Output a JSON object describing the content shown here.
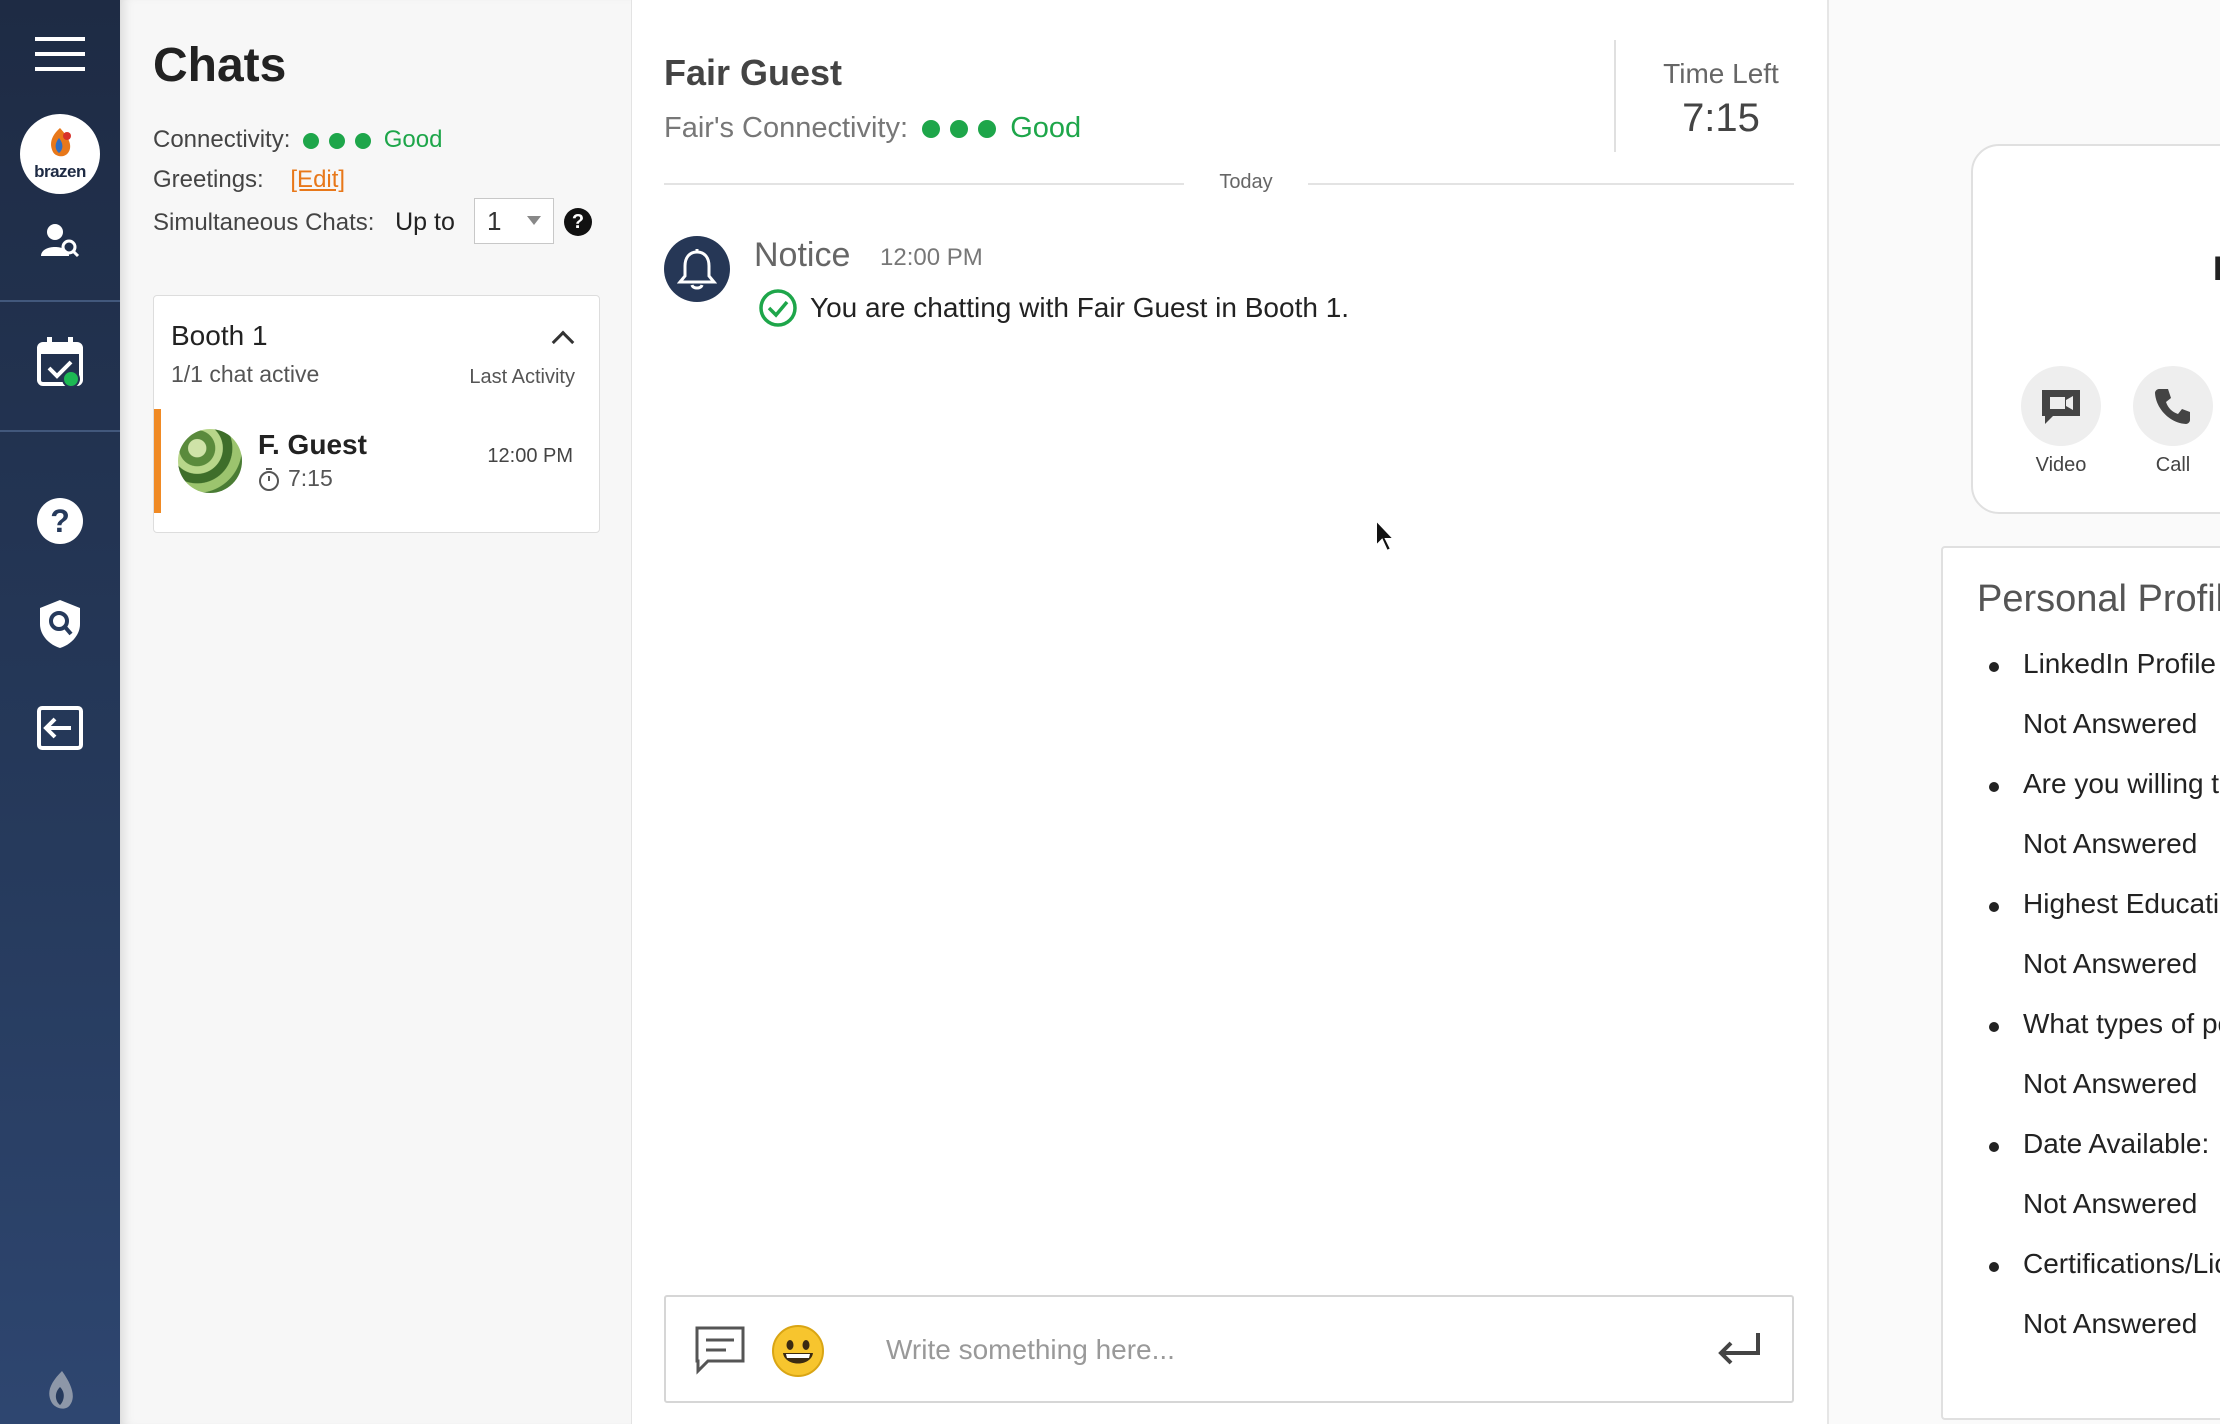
{
  "chats": {
    "title": "Chats",
    "connectivity_label": "Connectivity:",
    "connectivity_status": "Good",
    "greetings_label": "Greetings:",
    "greetings_edit": "[Edit]",
    "simultaneous_label": "Simultaneous Chats:",
    "up_to": "Up to",
    "simultaneous_value": "1",
    "help": "?"
  },
  "booth": {
    "name": "Booth 1",
    "active": "1/1 chat active",
    "last_activity": "Last Activity",
    "guest": {
      "name": "F. Guest",
      "timer": "7:15",
      "time": "12:00 PM"
    }
  },
  "chat": {
    "title": "Fair Guest",
    "connectivity_label": "Fair's Connectivity:",
    "connectivity_status": "Good",
    "time_left_label": "Time Left",
    "time_left_value": "7:15",
    "divider": "Today",
    "message": {
      "sender": "Notice",
      "time": "12:00 PM",
      "text": "You are chatting with Fair Guest in Booth 1."
    },
    "composer_placeholder": "Write something here..."
  },
  "call": {
    "initial": "F",
    "video_label": "Video",
    "call_label": "Call"
  },
  "profile": {
    "title": "Personal Profile",
    "items": [
      {
        "q": "LinkedIn Profile URL:",
        "a": "Not Answered"
      },
      {
        "q": "Are you willing to relo",
        "a": "Not Answered"
      },
      {
        "q": "Highest Education Le",
        "a": "Not Answered"
      },
      {
        "q": "What types of positio",
        "a": "Not Answered"
      },
      {
        "q": "Date Available:",
        "a": "Not Answered"
      },
      {
        "q": "Certifications/License",
        "a": "Not Answered"
      }
    ]
  },
  "colors": {
    "accent_orange": "#f08a24",
    "status_green": "#1ea64a",
    "sidebar_navy": "#1e2b44"
  },
  "icons": [
    "menu-icon",
    "brazen-logo",
    "user-search-icon",
    "calendar-check-icon",
    "help-icon",
    "shield-search-icon",
    "logout-icon",
    "brazen-mark-icon",
    "bell-icon",
    "check-circle-icon",
    "chat-bubble-icon",
    "emoji-icon",
    "enter-icon",
    "video-icon",
    "phone-icon",
    "stopwatch-icon",
    "chevron-up-icon"
  ]
}
